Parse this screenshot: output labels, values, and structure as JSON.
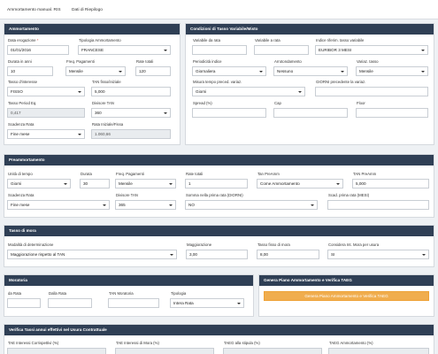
{
  "nav": {
    "tabs": [
      "Ammortamento manual. RIS",
      "Dati di Riepilogo"
    ]
  },
  "amm": {
    "title": "Ammortamento",
    "data_erogazione": {
      "label": "Data erogazione",
      "value": "01/01/2016"
    },
    "tipologia": {
      "label": "Tipologia Ammortamento",
      "value": "FRANCESE"
    },
    "durata": {
      "label": "Durata in anni",
      "value": "10"
    },
    "freq": {
      "label": "Freq. Pagamenti",
      "value": "Mensile"
    },
    "rate_totali": {
      "label": "Rate totali",
      "value": "120"
    },
    "tasso_interesse": {
      "label": "Tasso d'interesse",
      "value": "FISSO"
    },
    "tan_fisso": {
      "label": "TAN fisso/iniziale",
      "value": "5,000"
    },
    "tasso_period": {
      "label": "Tasso Period Eq.",
      "value": "0,417"
    },
    "divisore": {
      "label": "Divisore TAN",
      "value": "360"
    },
    "scadenza": {
      "label": "Scadenza Rata",
      "value": "Fine mese"
    },
    "rata_iniziale": {
      "label": "Rata Iniziale/Fissa",
      "value": "1.060,66"
    }
  },
  "cond": {
    "title": "Condizioni di Tasso Variabile/Misto",
    "variabile_da": {
      "label": "Variabile da rata",
      "value": ""
    },
    "variabile_a": {
      "label": "Variabile a rata",
      "value": ""
    },
    "indice": {
      "label": "Indice riferim. tasso variabile",
      "value": "EURIBOR 3 MESI"
    },
    "periodicita": {
      "label": "Periodicità indice",
      "value": "Giornaliera"
    },
    "arrotondamento": {
      "label": "Arrotondamento",
      "value": "Nessuno"
    },
    "variaz": {
      "label": "Variaz. tasso",
      "value": "Mensile"
    },
    "misura": {
      "label": "Misura tempo preced. variaz.",
      "value": "Giorni"
    },
    "giorni": {
      "label": "GIORNI precedente la variaz.",
      "value": ""
    },
    "spread": {
      "label": "Spread (%)",
      "value": ""
    },
    "cap": {
      "label": "Cap",
      "value": ""
    },
    "floor": {
      "label": "Floor",
      "value": ""
    }
  },
  "pre": {
    "title": "Preammortamento",
    "unita": {
      "label": "Unità di tempo",
      "value": "Giorni"
    },
    "durata": {
      "label": "Durata",
      "value": "30"
    },
    "freq": {
      "label": "Freq. Pagamenti",
      "value": "Mensile"
    },
    "rate_totali": {
      "label": "Rate totali",
      "value": "1"
    },
    "tan_preamm_label": {
      "label": "Tan PreAmm",
      "value": "Come Ammortamento"
    },
    "tan_preamm_value": {
      "label": "TAN PreAmm",
      "value": "5,000"
    },
    "scadenza": {
      "label": "Scadenza Rata",
      "value": "Fine mese"
    },
    "divisore": {
      "label": "Divisore TAN",
      "value": "365"
    },
    "somma": {
      "label": "Somma nella prima rata (DIORNI)",
      "value": "NO"
    },
    "scadenza_prima": {
      "label": "Scad. prima rata (MESI)",
      "value": ""
    }
  },
  "mora": {
    "title": "Tasso di mora",
    "modalita": {
      "label": "Modalità di determinazione",
      "value": "Maggiorazione rispetto al TAN"
    },
    "maggiorazione": {
      "label": "Maggiorazione",
      "value": "3,00"
    },
    "tasso_fisso": {
      "label": "Tasso fisso di mora",
      "value": "8,00"
    },
    "considera": {
      "label": "Considera Int. Mora per usura",
      "value": "SI"
    }
  },
  "moratoria": {
    "title": "Moratoria",
    "da_rata": {
      "label": "da Rata",
      "value": ""
    },
    "dalla_rata": {
      "label": "Dalla Rata",
      "value": ""
    },
    "tan": {
      "label": "TAN Moratoria",
      "value": ""
    },
    "tipologia": {
      "label": "Tipologia",
      "value": "Intera Rata"
    }
  },
  "genera": {
    "title": "Genera Piano Ammortamento e Verifica TAEG",
    "button": "Genera Piano Ammortamento e Verifica TAEG"
  },
  "verifica": {
    "title": "Verifica Tassi annui effettivi nel Usura Contrattuale",
    "labels": [
      "TAE Interessi Corrispettivi (%)",
      "TAE Interessi di Mora (%)",
      "TAEG alla stipula (%)",
      "TAEG Ammortamento (%)"
    ]
  },
  "colors": {
    "header": "#2f3f55",
    "accent": "#f0ad4e",
    "required": "#d9534f"
  }
}
